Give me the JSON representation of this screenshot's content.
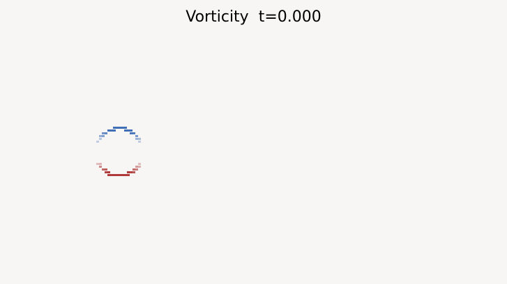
{
  "plot": {
    "title": "Vorticity  t=0.000",
    "background_color": "#f8f5f5",
    "colormap": "RdBu",
    "negative_vorticity_color": "#3f6fb7",
    "positive_vorticity_color": "#b03a3a"
  },
  "vortex_ring": {
    "upper_arc_sign": "negative",
    "lower_arc_sign": "positive"
  }
}
